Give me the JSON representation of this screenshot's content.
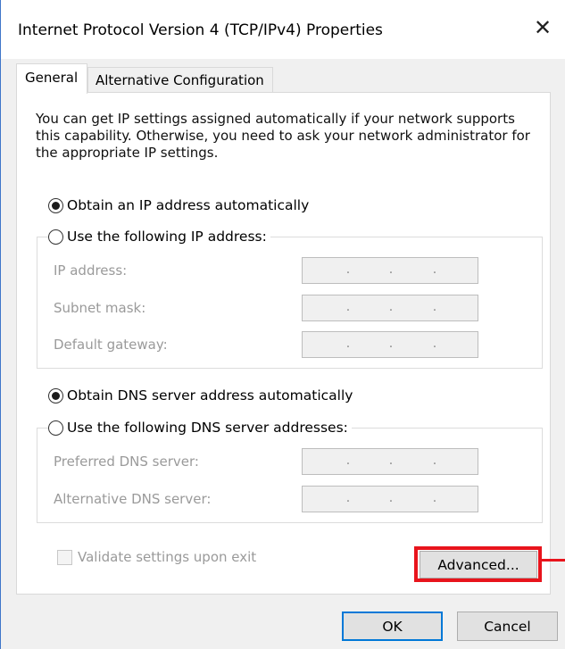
{
  "window": {
    "title": "Internet Protocol Version 4 (TCP/IPv4) Properties",
    "close_icon": "close-icon"
  },
  "tabs": [
    {
      "label": "General",
      "active": true
    },
    {
      "label": "Alternative Configuration",
      "active": false
    }
  ],
  "description": "You can get IP settings assigned automatically if your network supports this capability. Otherwise, you need to ask your network administrator for the appropriate IP settings.",
  "ip_mode": {
    "auto_label": "Obtain an IP address automatically",
    "manual_label": "Use the following IP address:",
    "selected": "auto"
  },
  "ip_fields": {
    "ip_address": {
      "label": "IP address:",
      "value": ".   .   ."
    },
    "subnet_mask": {
      "label": "Subnet mask:",
      "value": ".   .   ."
    },
    "default_gateway": {
      "label": "Default gateway:",
      "value": ".   .   ."
    }
  },
  "dns_mode": {
    "auto_label": "Obtain DNS server address automatically",
    "manual_label": "Use the following DNS server addresses:",
    "selected": "auto"
  },
  "dns_fields": {
    "preferred": {
      "label": "Preferred DNS server:",
      "value": ".   .   ."
    },
    "alternative": {
      "label": "Alternative DNS server:",
      "value": ".   .   ."
    }
  },
  "validate": {
    "label": "Validate settings upon exit",
    "checked": false,
    "enabled": false
  },
  "buttons": {
    "advanced": "Advanced...",
    "ok": "OK",
    "cancel": "Cancel"
  },
  "colors": {
    "highlight": "#e8141c",
    "accent": "#0078d7"
  }
}
